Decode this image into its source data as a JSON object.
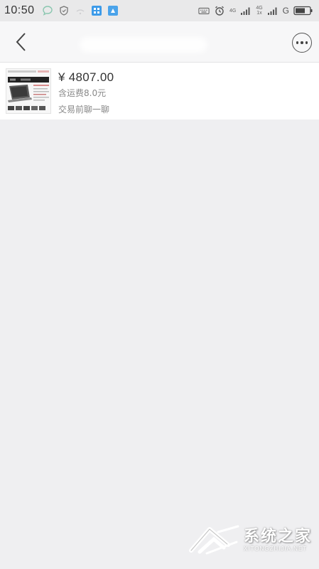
{
  "status_bar": {
    "time": "10:50",
    "network_labels": [
      "4G",
      "4G"
    ],
    "network_sub_labels": [
      "1x"
    ],
    "carrier_label": "G",
    "icons": [
      "message-app-icon",
      "shield-icon",
      "wifi-icon",
      "qr-app-icon",
      "app-icon",
      "keyboard-icon",
      "alarm-icon",
      "signal-icon",
      "signal-icon",
      "battery-icon"
    ]
  },
  "nav_bar": {
    "title": "",
    "back_icon": "chevron-left-icon",
    "more_icon": "more-horizontal-icon"
  },
  "item": {
    "price": "¥ 4807.00",
    "shipping": "含运费8.0元",
    "chat_link": "交易前聊一聊",
    "thumbnail": "laptop-product-thumbnail"
  },
  "watermark": {
    "main": "系统之家",
    "sub": "XITONGZHIJIA.NET"
  },
  "colors": {
    "background": "#efeff1",
    "card": "#ffffff",
    "status_bar": "#e9e9ea",
    "nav_bar": "#f7f7f8",
    "text_primary": "#333333",
    "text_secondary": "#888888"
  }
}
